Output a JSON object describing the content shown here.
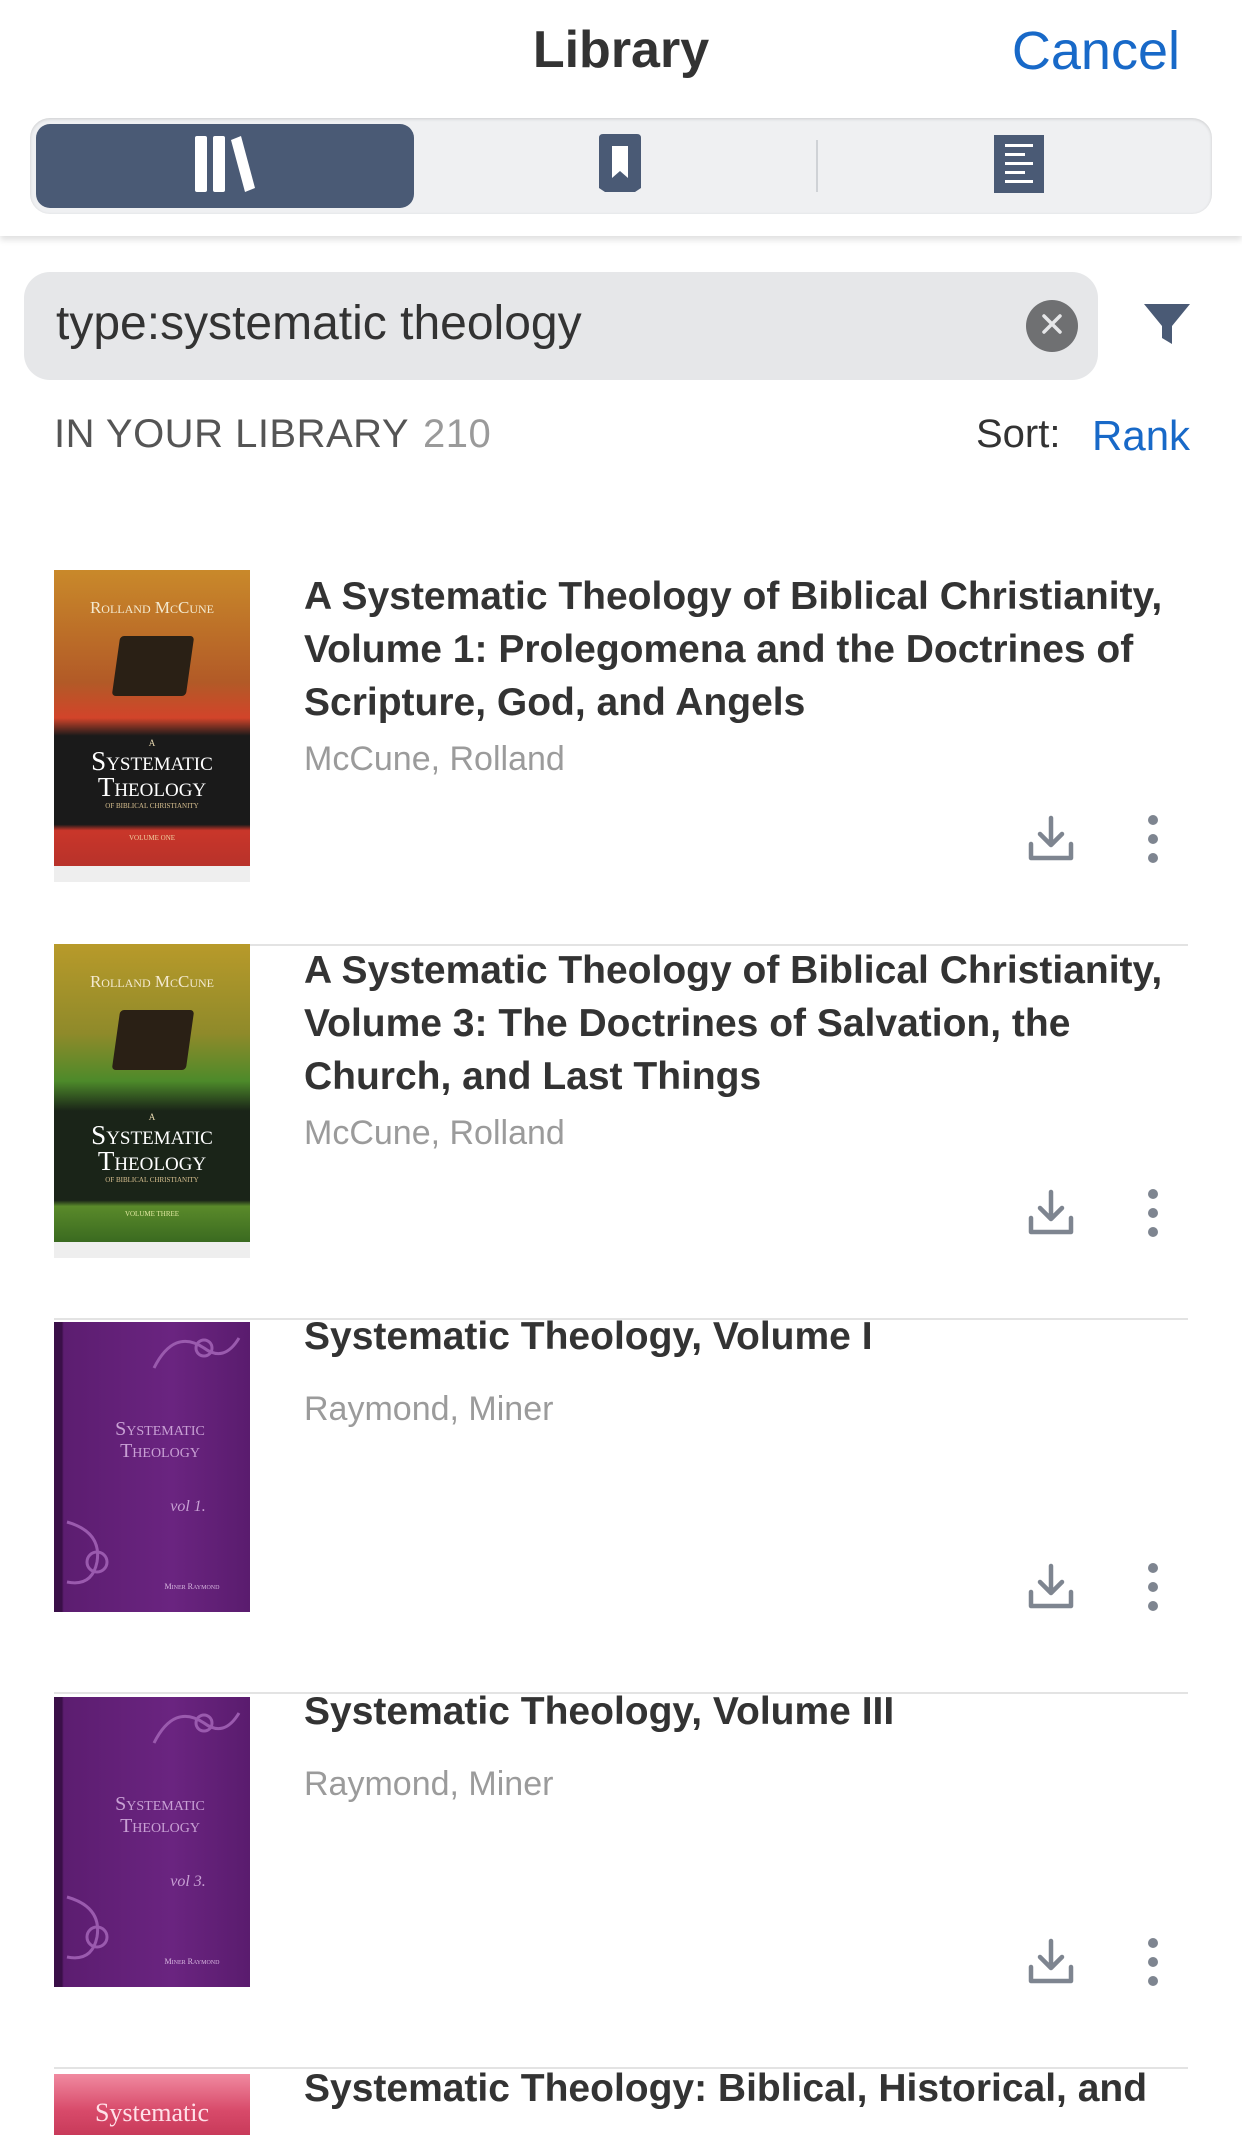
{
  "header": {
    "title": "Library",
    "cancel_label": "Cancel"
  },
  "segments": [
    {
      "icon": "library-icon",
      "active": true
    },
    {
      "icon": "bookmark-icon",
      "active": false
    },
    {
      "icon": "document-outline-icon",
      "active": false
    }
  ],
  "search": {
    "value": "type:systematic theology"
  },
  "library": {
    "label": "IN YOUR LIBRARY",
    "count": "210",
    "sort_label": "Sort:",
    "sort_value": "Rank"
  },
  "items": [
    {
      "title": "A Systematic Theology of Biblical Christianity, Volume 1: Prolegomena and the Doctrines of Scripture, God, and Angels",
      "author": "McCune, Rolland",
      "cover": {
        "author": "Rolland McCune",
        "small": "A",
        "line1": "Systematic",
        "line2": "Theology",
        "sub": "of Biblical Christianity",
        "volume": "Volume One"
      }
    },
    {
      "title": "A Systematic Theology of Biblical Christianity, Volume 3: The Doctrines of Salvation, the Church, and Last Things",
      "author": "McCune, Rolland",
      "cover": {
        "author": "Rolland McCune",
        "small": "A",
        "line1": "Systematic",
        "line2": "Theology",
        "sub": "of Biblical Christianity",
        "volume": "Volume Three"
      }
    },
    {
      "title": "Systematic Theology, Volume I",
      "author": "Raymond, Miner",
      "cover": {
        "line1": "Systematic",
        "line2": "Theology",
        "volume": "vol 1.",
        "author": "Miner Raymond"
      }
    },
    {
      "title": "Systematic Theology, Volume III",
      "author": "Raymond, Miner",
      "cover": {
        "line1": "Systematic",
        "line2": "Theology",
        "volume": "vol 3.",
        "author": "Miner Raymond"
      }
    },
    {
      "title": "Systematic Theology: Biblical, Historical, and",
      "cover": {
        "line1": "Systematic"
      }
    }
  ],
  "colors": {
    "accent": "#1869c8",
    "segment_active": "#4a5a75",
    "icon_gray": "#7e8590"
  }
}
